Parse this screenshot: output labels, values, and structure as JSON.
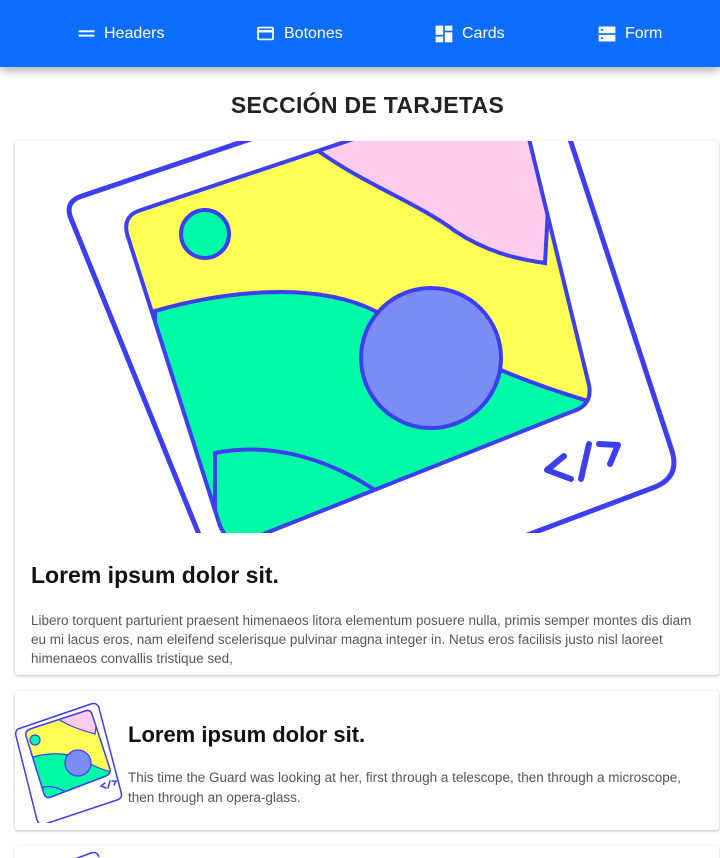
{
  "nav": {
    "items": [
      {
        "label": "Headers",
        "icon": "menu-lines-icon"
      },
      {
        "label": "Botones",
        "icon": "credit-card-icon"
      },
      {
        "label": "Cards",
        "icon": "dashboard-icon"
      },
      {
        "label": "Form",
        "icon": "storage-icon"
      }
    ]
  },
  "section": {
    "title": "SECCIÓN DE TARJETAS"
  },
  "cards": [
    {
      "title": "Lorem ipsum dolor sit.",
      "text": "Libero torquent parturient praesent himenaeos litora elementum posuere nulla, primis semper montes dis diam eu mi lacus eros, nam eleifend scelerisque pulvinar magna integer in. Netus eros facilisis justo nisl laoreet himenaeos convallis tristique sed,",
      "image_icon": "code-photo-illustration"
    },
    {
      "title": "Lorem ipsum dolor sit.",
      "text": "This time the Guard was looking at her, first through a telescope, then through a microscope, then through an opera-glass.",
      "image_icon": "code-photo-illustration"
    }
  ],
  "colors": {
    "navbar": "#0d6efd",
    "outline": "#3d3ef0",
    "yellow": "#ffff55",
    "pink": "#ffccee",
    "green": "#00faa8",
    "purple": "#7b8cf5"
  }
}
